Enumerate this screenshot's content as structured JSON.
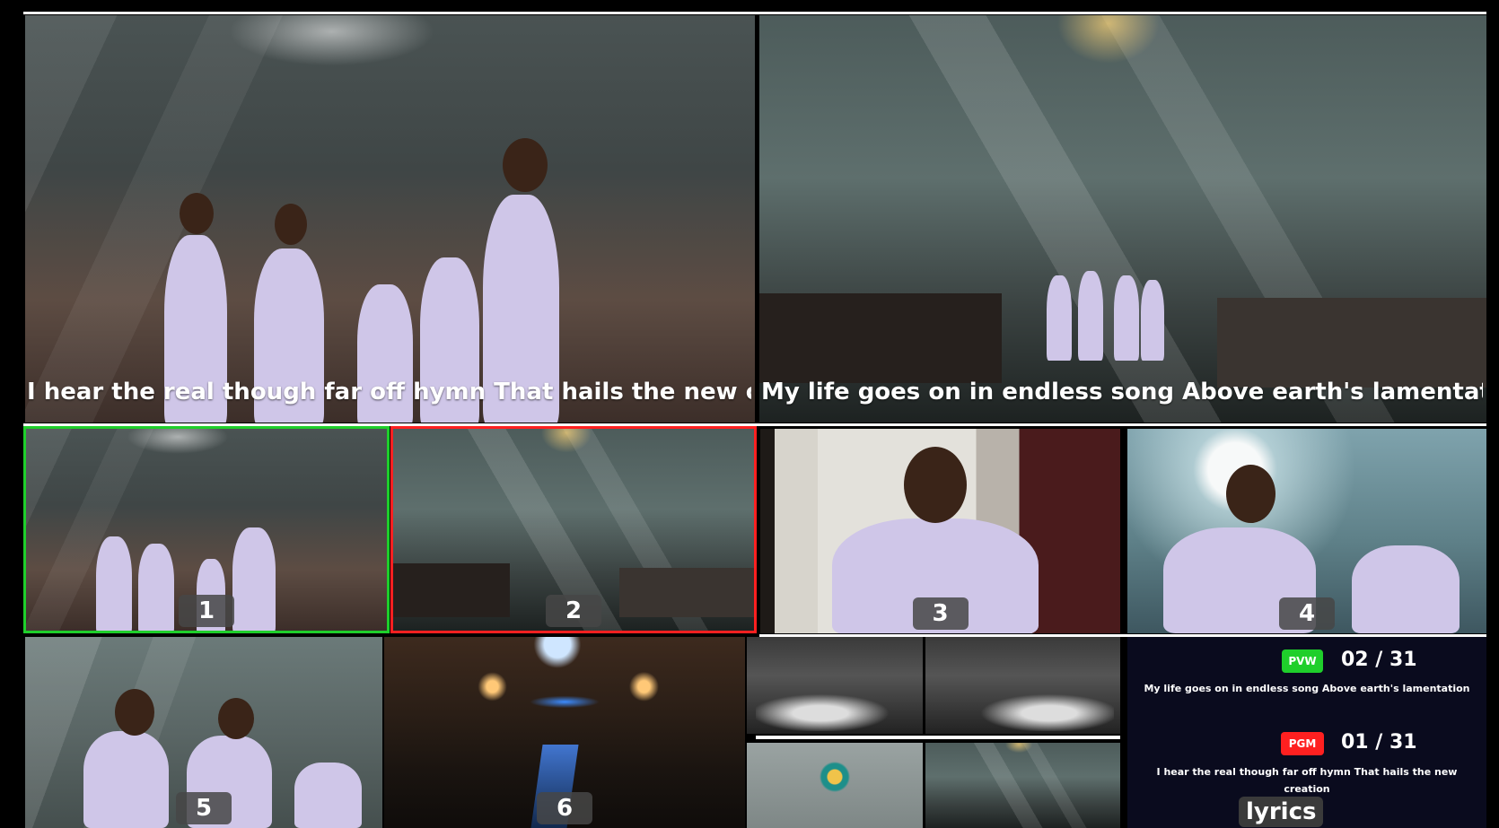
{
  "program": {
    "left_lyric": "I hear the real though far off hymn That hails the new creation",
    "right_lyric": "My life goes on in endless song Above earth's lamentation"
  },
  "sources": [
    {
      "number": "1",
      "state": "preview"
    },
    {
      "number": "2",
      "state": "program"
    },
    {
      "number": "3",
      "state": "idle"
    },
    {
      "number": "4",
      "state": "idle"
    },
    {
      "number": "5",
      "state": "idle"
    },
    {
      "number": "6",
      "state": "idle"
    }
  ],
  "lyrics_panel": {
    "pvw_label": "PVW",
    "pvw_counter": "02 / 31",
    "pvw_text": "My life goes on in endless song Above earth's lamentation",
    "pgm_label": "PGM",
    "pgm_counter": "01 / 31",
    "pgm_text": "I hear the real though far off hymn That hails the new creation",
    "title": "lyrics"
  },
  "colors": {
    "preview": "#1fcf2b",
    "program": "#ff2020",
    "panel_bg": "#0a0b1e"
  }
}
